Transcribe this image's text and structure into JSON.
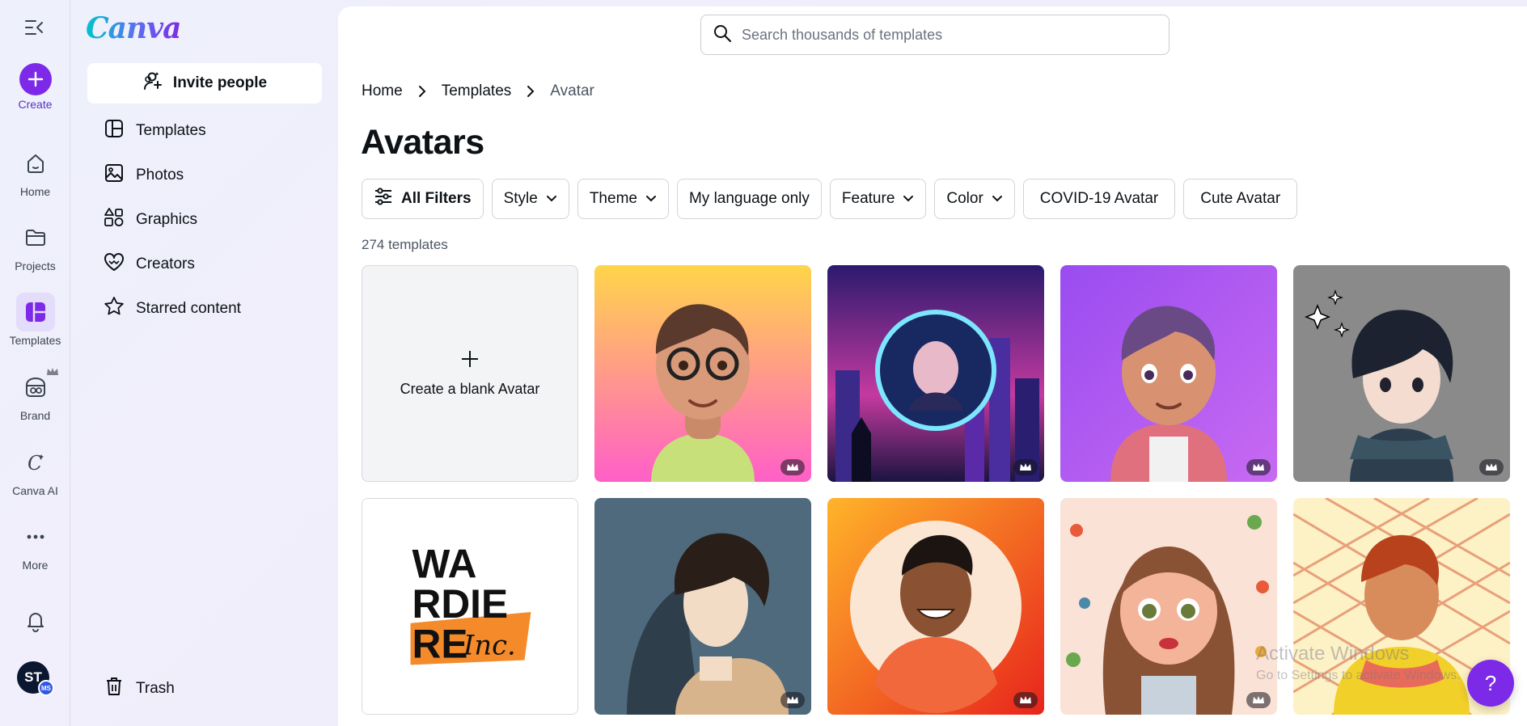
{
  "rail": {
    "items": [
      {
        "label": "Create"
      },
      {
        "label": "Home"
      },
      {
        "label": "Projects"
      },
      {
        "label": "Templates"
      },
      {
        "label": "Brand"
      },
      {
        "label": "Canva AI"
      },
      {
        "label": "More"
      }
    ],
    "user_initials": "ST",
    "user_badge": "MS"
  },
  "panel": {
    "logo": "Canva",
    "invite_label": "Invite people",
    "nav": [
      {
        "label": "Templates",
        "icon": "templates-icon"
      },
      {
        "label": "Photos",
        "icon": "photos-icon"
      },
      {
        "label": "Graphics",
        "icon": "graphics-icon"
      },
      {
        "label": "Creators",
        "icon": "creators-icon"
      },
      {
        "label": "Starred content",
        "icon": "star-icon"
      }
    ],
    "trash_label": "Trash"
  },
  "search": {
    "placeholder": "Search thousands of templates"
  },
  "breadcrumb": [
    "Home",
    "Templates",
    "Avatar"
  ],
  "page_title": "Avatars",
  "filters": [
    {
      "label": "All Filters",
      "dropdown": false
    },
    {
      "label": "Style",
      "dropdown": true
    },
    {
      "label": "Theme",
      "dropdown": true
    },
    {
      "label": "My language only",
      "dropdown": false
    },
    {
      "label": "Feature",
      "dropdown": true
    },
    {
      "label": "Color",
      "dropdown": true
    },
    {
      "label": "COVID-19 Avatar",
      "dropdown": false
    },
    {
      "label": "Cute Avatar",
      "dropdown": false
    }
  ],
  "template_count": "274 templates",
  "blank_card_label": "Create a blank Avatar",
  "templates": [
    {
      "desc": "cartoon boy with glasses",
      "premium": true
    },
    {
      "desc": "neon city portrait",
      "premium": true
    },
    {
      "desc": "cartoon boy purple background",
      "premium": true
    },
    {
      "desc": "anime boy with scarf",
      "premium": true
    },
    {
      "desc": "wardiere logo",
      "premium": false,
      "text_lines": [
        "WA",
        "RDIE",
        "RE"
      ],
      "script_text": "Inc."
    },
    {
      "desc": "anime man profile",
      "premium": true
    },
    {
      "desc": "smiling man orange circle",
      "premium": true
    },
    {
      "desc": "cartoon girl with earrings",
      "premium": true
    },
    {
      "desc": "boy with plaid scarf",
      "premium": false
    }
  ],
  "watermark": {
    "line1": "Activate Windows",
    "line2": "Go to Settings to activate Windows."
  },
  "help_label": "?",
  "colors": {
    "brand_purple": "#7d2ae8",
    "accent_teal": "#00c4cc"
  }
}
